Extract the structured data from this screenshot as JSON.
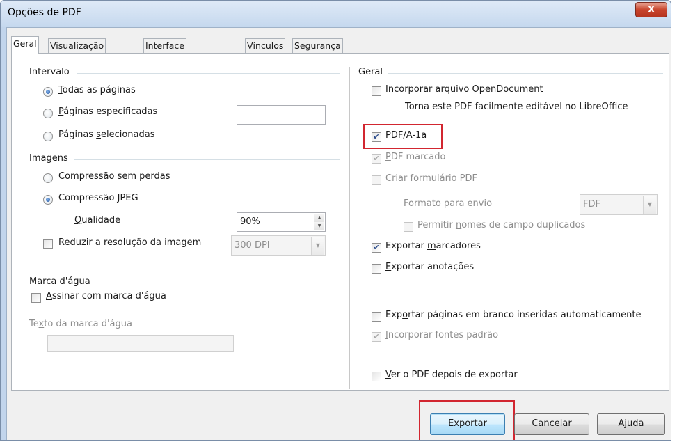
{
  "window": {
    "title": "Opções de PDF",
    "close_glyph": "x"
  },
  "tabs": [
    "Geral",
    "Visualização inicial",
    "Interface do usuário",
    "Vínculos",
    "Segurança"
  ],
  "left": {
    "range": {
      "heading": "Intervalo",
      "options": [
        {
          "pre": "",
          "key": "T",
          "post": "odas as páginas",
          "selected": true
        },
        {
          "pre": "",
          "key": "P",
          "post": "áginas especificadas",
          "selected": false
        },
        {
          "pre": "Páginas ",
          "key": "s",
          "post": "elecionadas",
          "selected": false
        }
      ],
      "pages_value": ""
    },
    "images": {
      "heading": "Imagens",
      "lossless": {
        "pre": "",
        "key": "C",
        "post": "ompressão sem perdas",
        "selected": false
      },
      "jpeg": {
        "pre": "Compressão ",
        "key": "J",
        "post": "PEG",
        "selected": true
      },
      "quality": {
        "pre": "",
        "key": "Q",
        "post": "ualidade",
        "value": "90%"
      },
      "reduce": {
        "pre": "",
        "key": "R",
        "post": "eduzir a resolução da imagem",
        "checked": false,
        "dpi": "300 DPI"
      }
    },
    "watermark": {
      "heading": "Marca d'água",
      "sign": {
        "pre": "",
        "key": "A",
        "post": "ssinar com marca d'água",
        "checked": false
      },
      "text_label": {
        "pre": "Te",
        "key": "x",
        "post": "to da marca d'água"
      },
      "text_value": ""
    }
  },
  "right": {
    "heading": "Geral",
    "embed": {
      "pre": "In",
      "key": "c",
      "post": "orporar arquivo OpenDocument",
      "checked": false
    },
    "embed_hint": "Torna este PDF facilmente editável no LibreOffice",
    "pdfa": {
      "pre": "",
      "key": "P",
      "post": "DF/A-1a",
      "checked": true
    },
    "tagged": {
      "pre": "",
      "key": "P",
      "post": "DF marcado",
      "checked": true
    },
    "form": {
      "pre": "Criar ",
      "key": "f",
      "post": "ormulário PDF",
      "checked": false
    },
    "submit_format": {
      "pre": "",
      "key": "F",
      "post": "ormato para envio",
      "value": "FDF"
    },
    "dup_fields": {
      "pre": "Permitir ",
      "key": "n",
      "post": "omes de campo duplicados",
      "checked": false
    },
    "bookmarks": {
      "pre": "Exportar ",
      "key": "m",
      "post": "arcadores",
      "checked": true
    },
    "comments": {
      "pre": "",
      "key": "E",
      "post": "xportar anotações",
      "checked": false
    },
    "blank_pages": {
      "pre": "Exp",
      "key": "o",
      "post": "rtar páginas em branco inseridas automaticamente",
      "checked": false
    },
    "std_fonts": {
      "pre": "",
      "key": "I",
      "post": "ncorporar fontes padrão",
      "checked": true
    },
    "view_after": {
      "pre": "",
      "key": "V",
      "post": "er o PDF depois de exportar",
      "checked": false
    }
  },
  "buttons": {
    "export": {
      "pre": "",
      "key": "E",
      "post": "xportar"
    },
    "cancel": {
      "pre": "Cancelar",
      "key": "",
      "post": ""
    },
    "help": {
      "pre": "Aj",
      "key": "u",
      "post": "da"
    }
  },
  "glyphs": {
    "check": "✔",
    "spin_up": "▲",
    "spin_down": "▼",
    "dropdown": "▼"
  },
  "colors": {
    "highlight": "#d22630",
    "title_bar": "#c5d8ee",
    "close_button": "#c8452d",
    "default_button": "#bee6fd"
  }
}
